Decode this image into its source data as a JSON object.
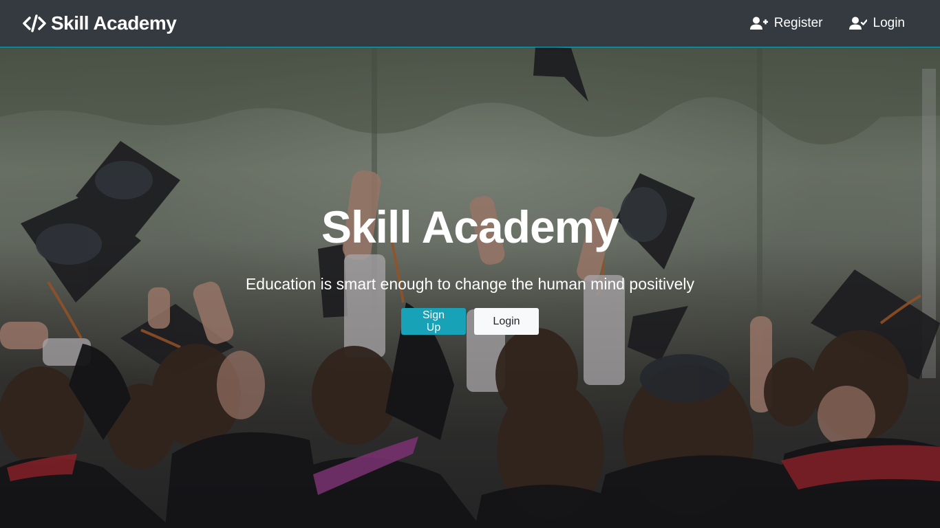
{
  "navbar": {
    "brand": "Skill Academy",
    "brand_icon": "code-icon",
    "links": [
      {
        "label": "Register",
        "icon": "user-plus-icon"
      },
      {
        "label": "Login",
        "icon": "user-check-icon"
      }
    ]
  },
  "hero": {
    "title": "Skill Academy",
    "subtitle": "Education is smart enough to change the human mind positively",
    "buttons": {
      "signup": "Sign Up",
      "login": "Login"
    },
    "background": "graduation-caps-photo"
  },
  "colors": {
    "navbar_bg": "#343a40",
    "accent": "#17a2b8",
    "light_button": "#f8f9fa"
  }
}
